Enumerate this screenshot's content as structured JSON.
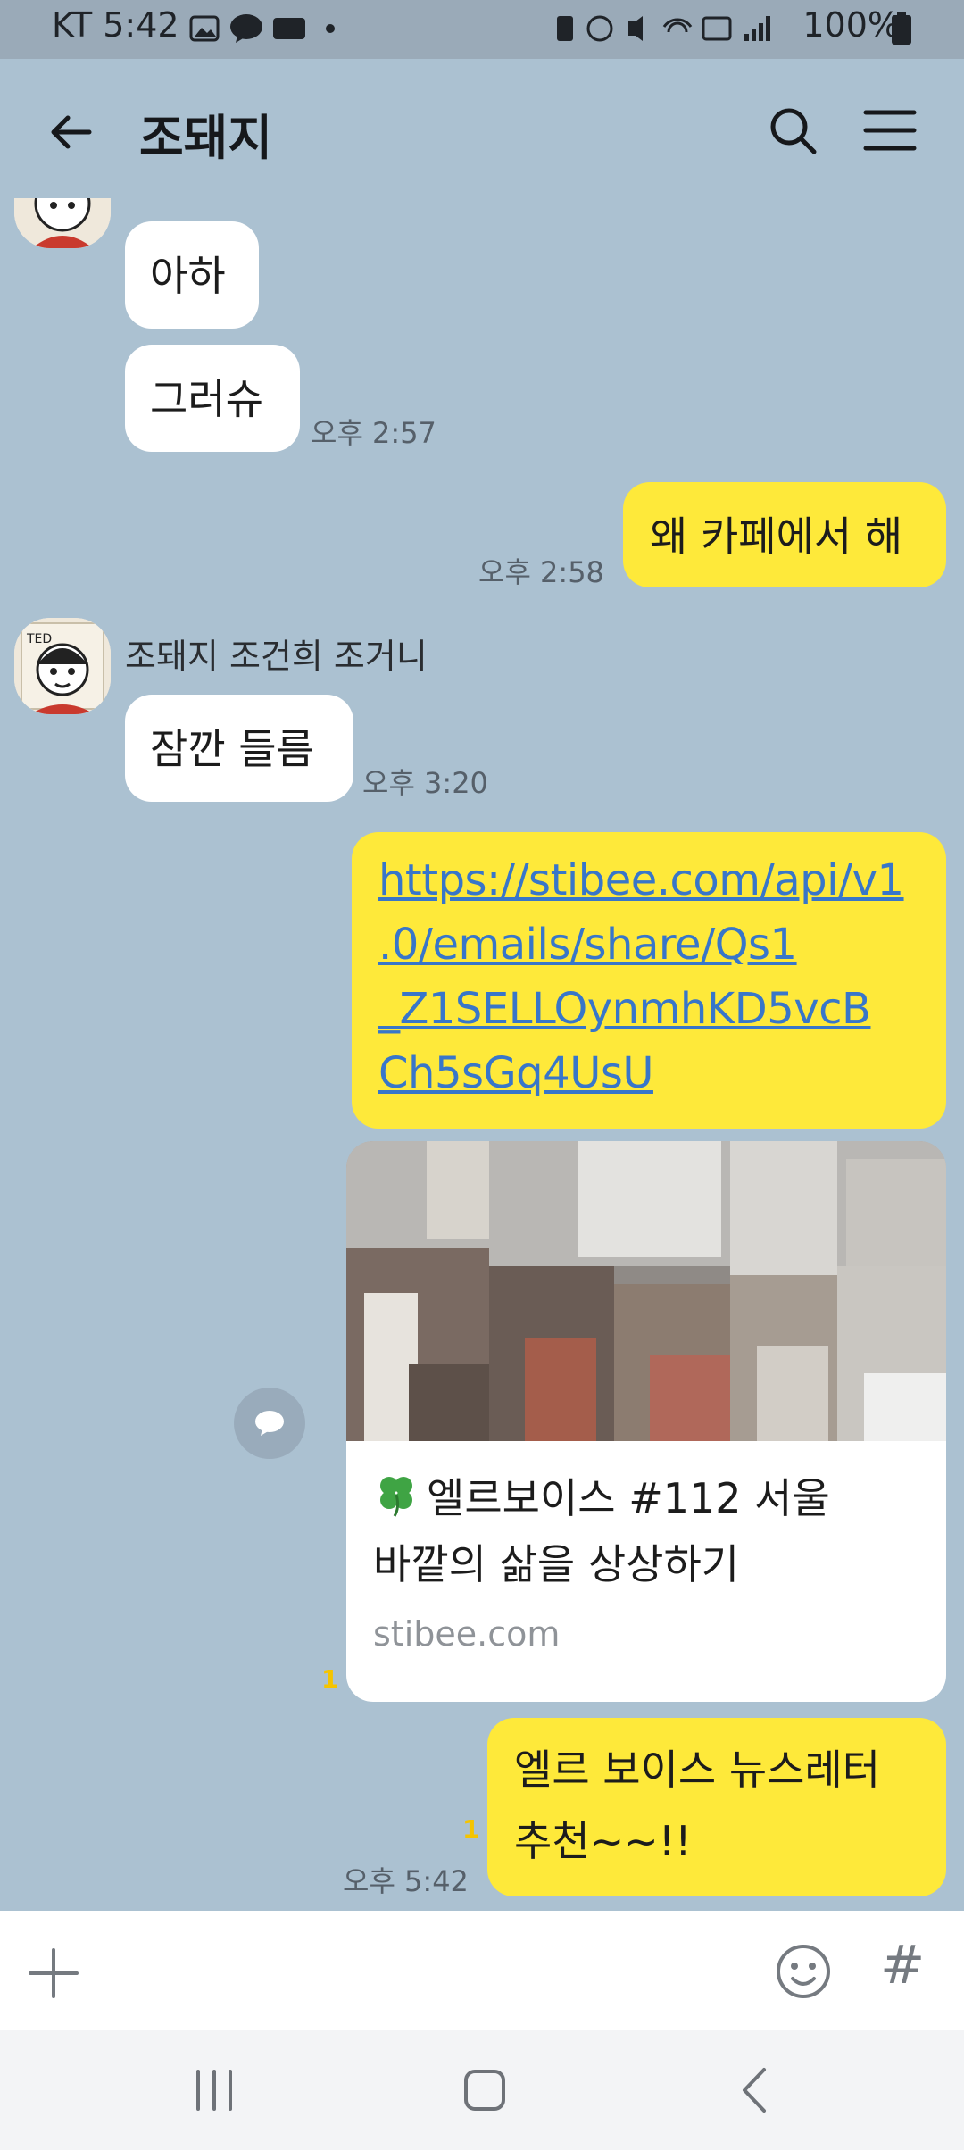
{
  "status_bar": {
    "carrier_time": "KT 5:42",
    "battery": "100%"
  },
  "header": {
    "title": "조돼지"
  },
  "messages": {
    "m1": "아하",
    "m2": "그러슈",
    "m2_time": "오후 2:57",
    "m3": "왜 카페에서 해",
    "m3_time": "오후 2:58",
    "sender": "조돼지 조건희 조거니",
    "m4": "잠깐 들름",
    "m4_time": "오후 3:20",
    "link_line1": "https://stibee.com/api/v1",
    "link_line2": ".0/emails/share/Qs1",
    "link_line3": "_Z1SELLOynmhKD5vcB",
    "link_line4": "Ch5sGq4UsU",
    "card_title_line1": "엘르보이스 #112 서울",
    "card_title_line2": "바깥의 삶을 상상하기",
    "card_domain": "stibee.com",
    "card_unread": "1",
    "m6_line1": "엘르 보이스 뉴스레터",
    "m6_line2": "추천~~!!",
    "m6_unread": "1",
    "m6_time": "오후 5:42"
  },
  "input": {
    "hash": "#"
  },
  "colors": {
    "chat_bg": "#abc1d1",
    "my_bubble": "#fee93a",
    "their_bubble": "#ffffff",
    "link": "#3876c9"
  },
  "icons": [
    "back-arrow-icon",
    "search-icon",
    "menu-icon",
    "share-icon",
    "plus-icon",
    "emoji-icon",
    "recents-icon",
    "home-icon",
    "back-nav-icon"
  ]
}
